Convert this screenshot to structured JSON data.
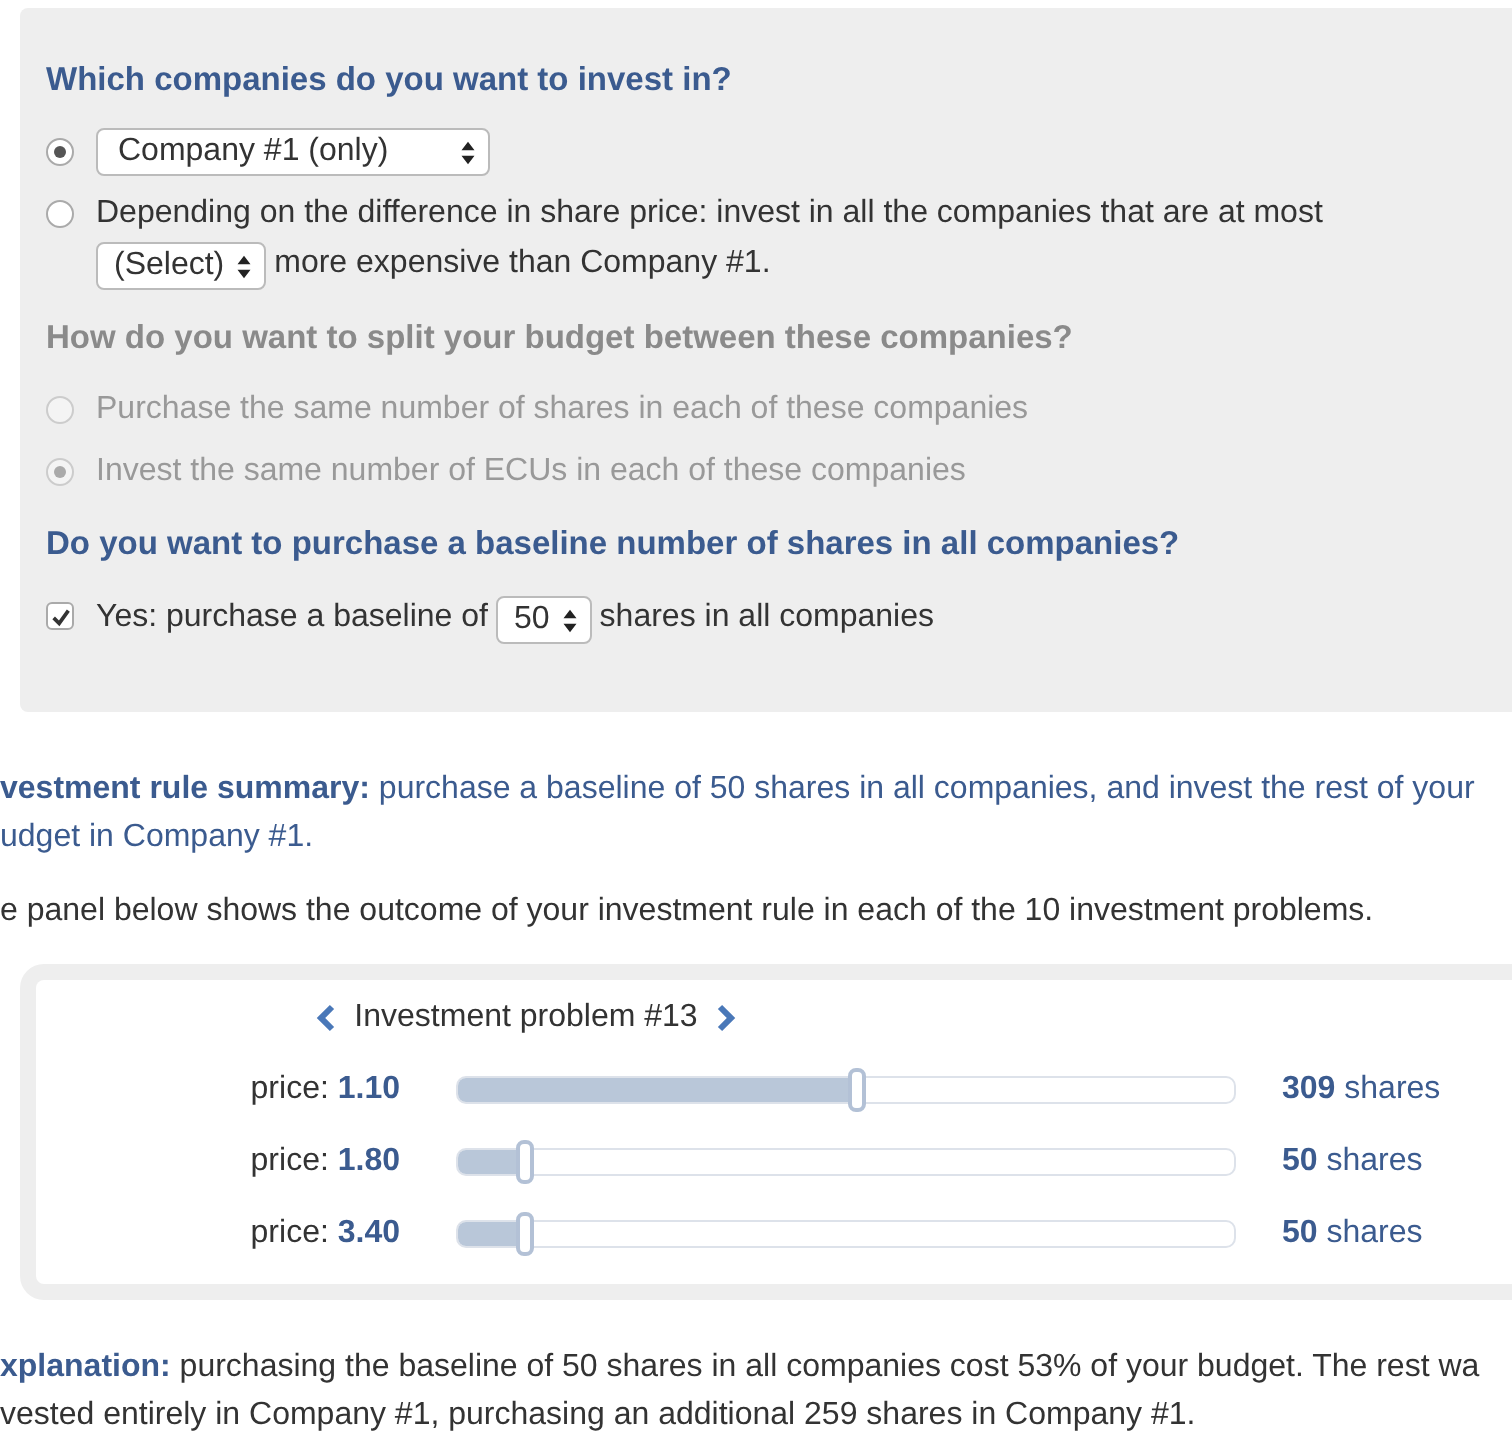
{
  "form": {
    "questions": [
      {
        "heading": "Which companies do you want to invest in?",
        "disabled": false,
        "options": [
          {
            "kind": "radio",
            "selected": true,
            "disabled": false,
            "segments": [
              {
                "kind": "select",
                "value": "Company #1 (only)"
              }
            ]
          },
          {
            "kind": "radio",
            "selected": false,
            "disabled": false,
            "segments": [
              {
                "kind": "text",
                "text": "Depending on the difference in share price: invest in all the companies that are at most"
              },
              {
                "kind": "select",
                "value": "(Select)"
              },
              {
                "kind": "text",
                "text": "more expensive than Company #1."
              }
            ]
          }
        ]
      },
      {
        "heading": "How do you want to split your budget between these companies?",
        "disabled": true,
        "options": [
          {
            "kind": "radio",
            "selected": false,
            "disabled": true,
            "segments": [
              {
                "kind": "text",
                "text": "Purchase the same number of shares in each of these companies"
              }
            ]
          },
          {
            "kind": "radio",
            "selected": true,
            "disabled": true,
            "segments": [
              {
                "kind": "text",
                "text": "Invest the same number of ECUs in each of these companies"
              }
            ]
          }
        ]
      },
      {
        "heading": "Do you want to purchase a baseline number of shares in all companies?",
        "disabled": false,
        "options": [
          {
            "kind": "checkbox",
            "checked": true,
            "disabled": false,
            "segments": [
              {
                "kind": "text",
                "text": "Yes: purchase a baseline of"
              },
              {
                "kind": "select",
                "value": "50"
              },
              {
                "kind": "text",
                "text": "shares in all companies"
              }
            ]
          }
        ]
      }
    ]
  },
  "summary": {
    "lines": [
      "**vestment rule summary:** purchase a baseline of 50 shares in all companies, and invest the rest of your",
      "udget in Company #1."
    ]
  },
  "intro": "e panel below shows the outcome of your investment rule in each of the 10 investment problems.",
  "problem": {
    "title": "Investment problem #13",
    "rows": [
      {
        "price": "price: **1.10**",
        "level": 0.515,
        "shares": "**309** shares"
      },
      {
        "price": "price: **1.80**",
        "level": 0.087,
        "shares": "**50** shares"
      },
      {
        "price": "price: **3.40**",
        "level": 0.087,
        "shares": "**50** shares"
      }
    ]
  },
  "explanation": {
    "lines": [
      "**xplanation:** purchasing the baseline of 50 shares in all companies cost 53% of your budget. The rest wa",
      "vested entirely in Company #1, purchasing an additional 259 shares in Company #1."
    ]
  }
}
